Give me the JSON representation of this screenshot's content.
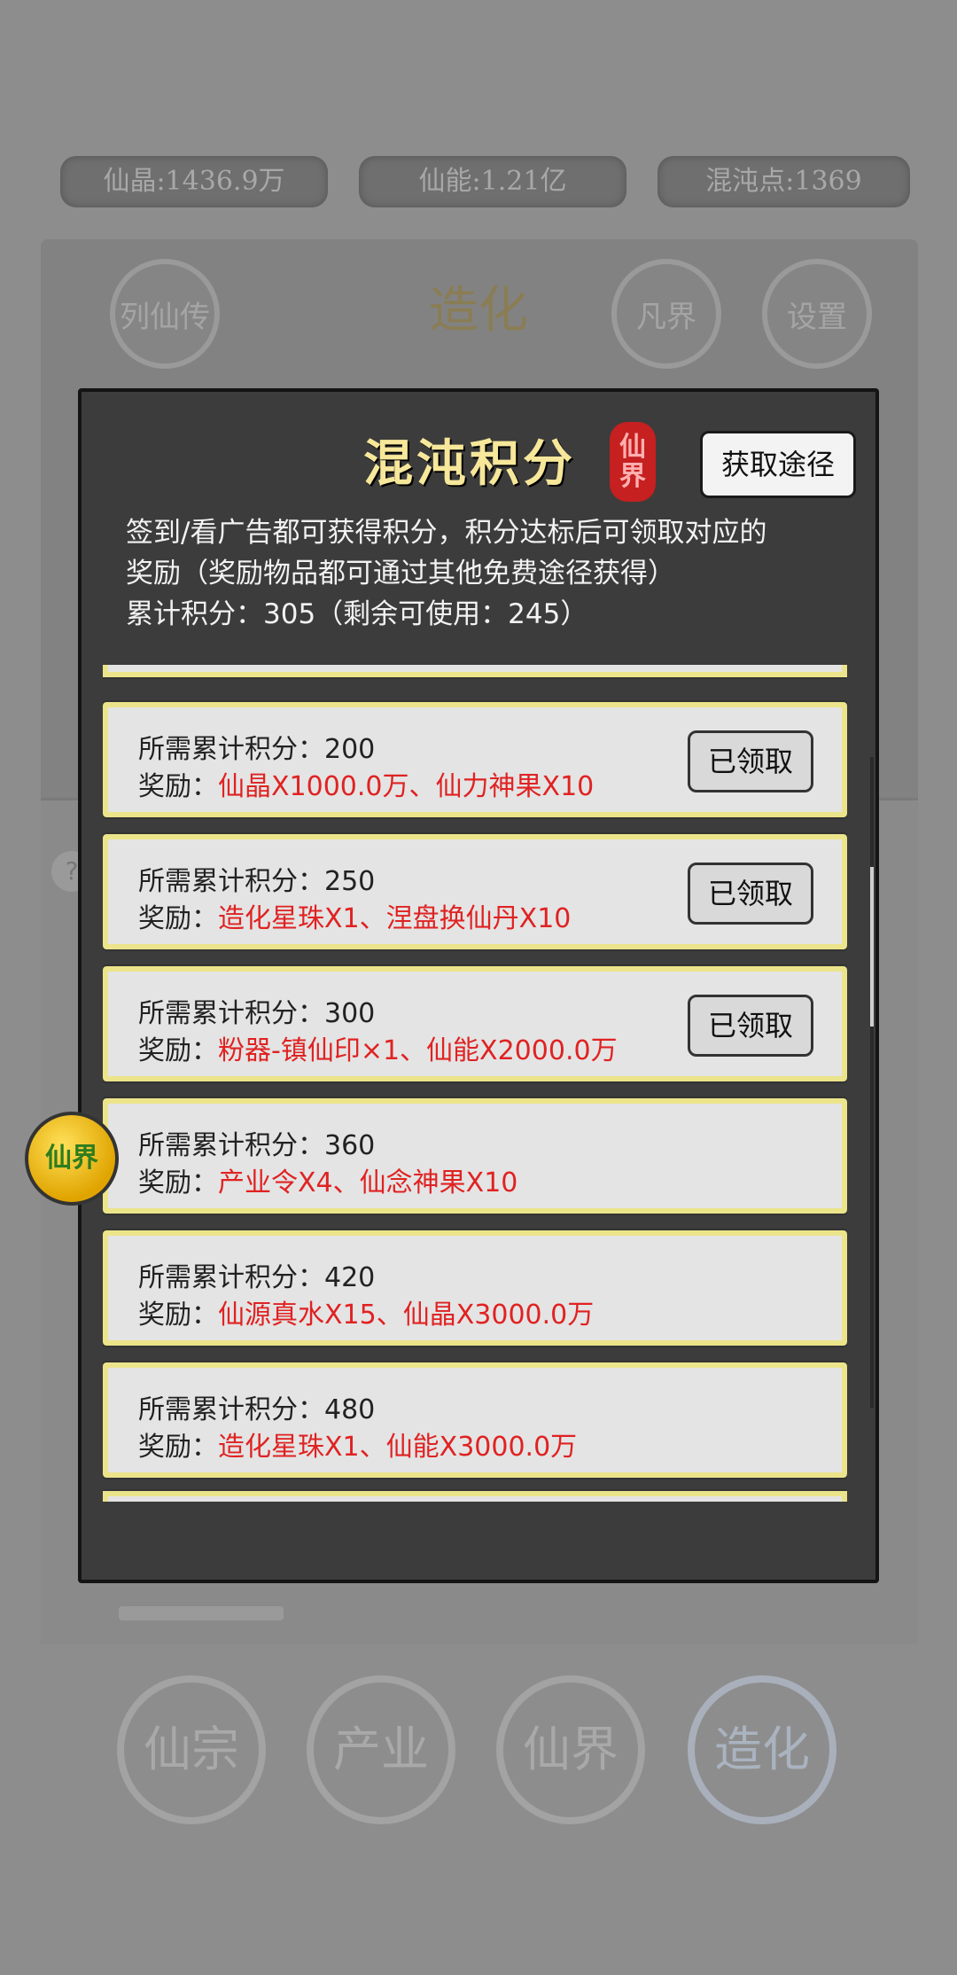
{
  "resources": {
    "xianjing": "仙晶:1436.9万",
    "xianneng": "仙能:1.21亿",
    "hundundian": "混沌点:1369"
  },
  "background": {
    "title": "造化",
    "buttons": [
      "列仙传",
      "凡界",
      "设置"
    ],
    "help": "?"
  },
  "bottom_nav": [
    "仙宗",
    "产业",
    "仙界",
    "造化"
  ],
  "float_badge": "仙界",
  "modal": {
    "title": "混沌积分",
    "seal": "仙界",
    "obtain_button": "获取途径",
    "desc_line1": "签到/看广告都可获得积分，积分达标后可领取对应的",
    "desc_line2": "奖励（奖励物品都可通过其他免费途径获得）",
    "desc_line3": "累计积分：305（剩余可使用：245）",
    "req_prefix": "所需累计积分：",
    "reward_prefix": "奖励：",
    "claimed_label": "已领取",
    "rewards": [
      {
        "points": "200",
        "reward": "仙晶X1000.0万、仙力神果X10",
        "claimed": true
      },
      {
        "points": "250",
        "reward": "造化星珠X1、涅盘换仙丹X10",
        "claimed": true
      },
      {
        "points": "300",
        "reward": "粉器-镇仙印×1、仙能X2000.0万",
        "claimed": true
      },
      {
        "points": "360",
        "reward": "产业令X4、仙念神果X10",
        "claimed": false
      },
      {
        "points": "420",
        "reward": "仙源真水X15、仙晶X3000.0万",
        "claimed": false
      },
      {
        "points": "480",
        "reward": "造化星珠X1、仙能X3000.0万",
        "claimed": false
      }
    ]
  }
}
